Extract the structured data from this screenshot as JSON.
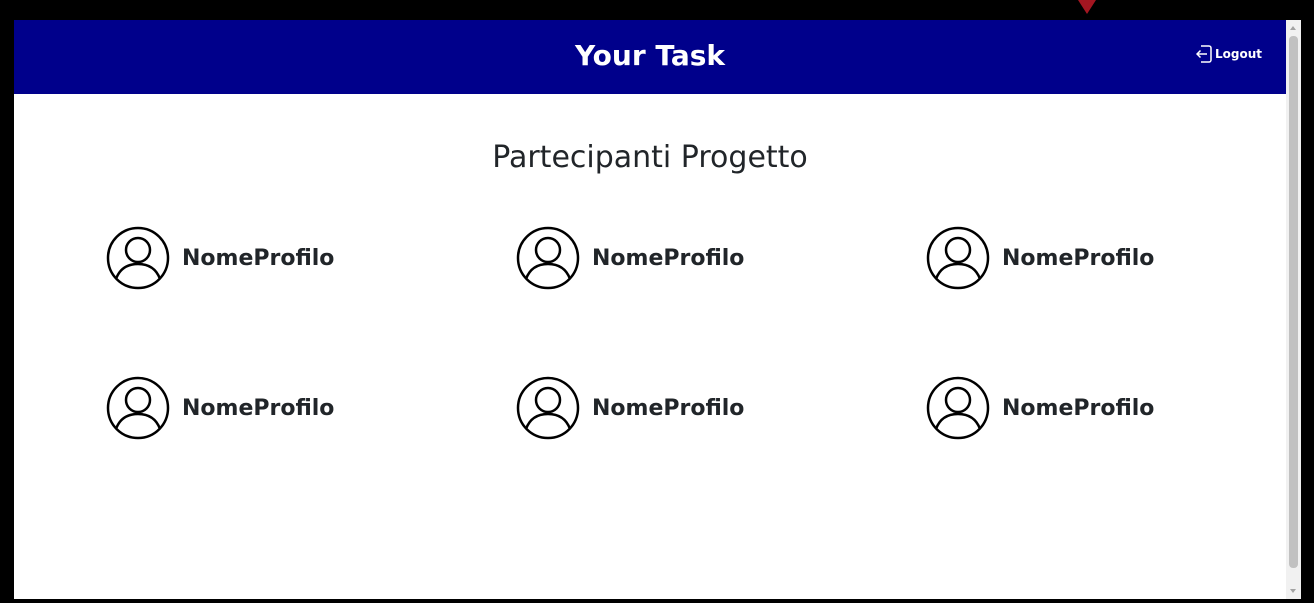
{
  "header": {
    "title": "Your Task",
    "logout_label": "Logout",
    "logout_icon": "logout-icon",
    "background": "#00008b"
  },
  "main": {
    "title": "Partecipanti Progetto",
    "members": [
      {
        "name": "NomeProfilo",
        "icon": "person-circle-icon"
      },
      {
        "name": "NomeProfilo",
        "icon": "person-circle-icon"
      },
      {
        "name": "NomeProfilo",
        "icon": "person-circle-icon"
      },
      {
        "name": "NomeProfilo",
        "icon": "person-circle-icon"
      },
      {
        "name": "NomeProfilo",
        "icon": "person-circle-icon"
      },
      {
        "name": "NomeProfilo",
        "icon": "person-circle-icon"
      }
    ]
  },
  "colors": {
    "frame": "#000000",
    "marker": "#a31621"
  }
}
